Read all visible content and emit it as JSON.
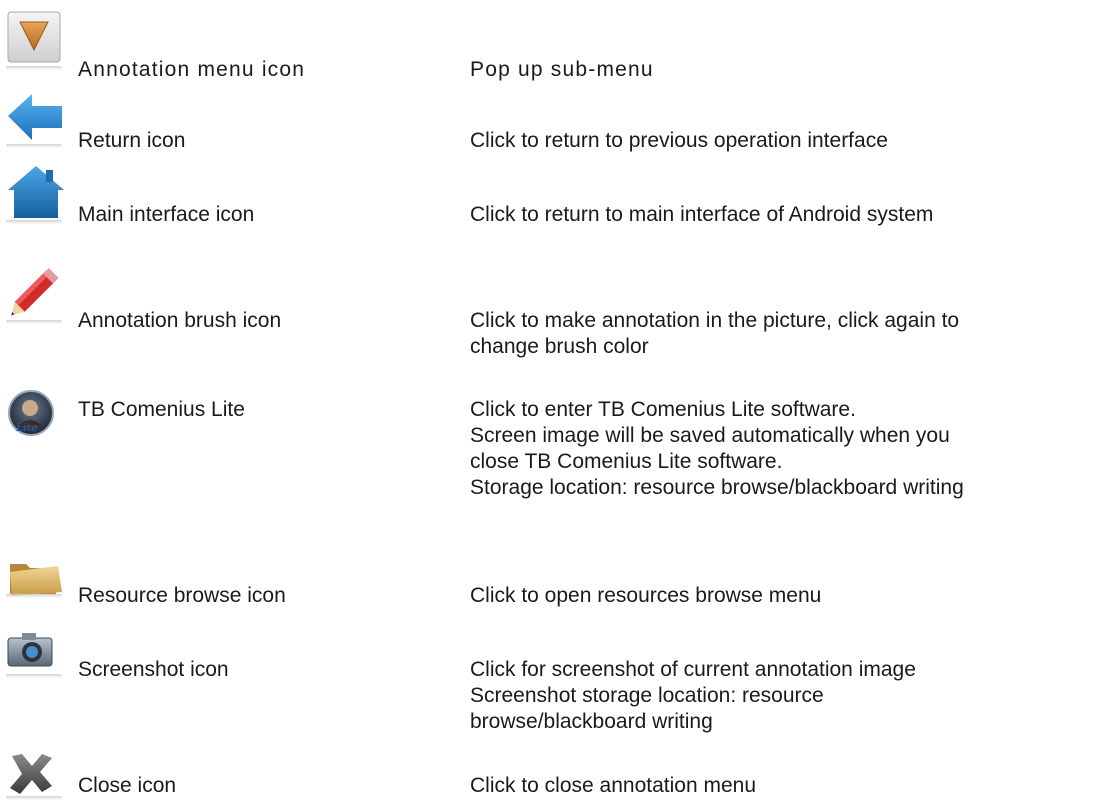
{
  "rows": [
    {
      "name": "Annotation menu icon",
      "desc": [
        "Pop up sub-menu"
      ],
      "icon": "triangle-down-icon"
    },
    {
      "name": "Return icon",
      "desc": [
        "Click to return to previous operation interface"
      ],
      "icon": "arrow-left-icon"
    },
    {
      "name": "Main interface icon",
      "desc": [
        "Click to return to main interface of Android system"
      ],
      "icon": "home-icon"
    },
    {
      "name": "Annotation brush icon",
      "desc": [
        "Click to make annotation in the picture, click again to",
        "change brush color"
      ],
      "icon": "pencil-icon"
    },
    {
      "name": "TB Comenius Lite",
      "desc": [
        "Click to enter TB Comenius Lite software.",
        "Screen image will be saved automatically when you",
        "close TB Comenius Lite software.",
        "Storage location: resource browse/blackboard writing"
      ],
      "icon": "comenius-lite-icon",
      "icon_text": "Lite"
    },
    {
      "name": "Resource browse icon",
      "desc": [
        "Click to open resources browse menu"
      ],
      "icon": "folder-icon"
    },
    {
      "name": "Screenshot icon",
      "desc": [
        "Click for screenshot of current annotation image",
        "Screenshot storage location: resource",
        "browse/blackboard writing"
      ],
      "icon": "camera-icon"
    },
    {
      "name": "Close icon",
      "desc": [
        "Click to close annotation menu"
      ],
      "icon": "close-x-icon"
    }
  ],
  "colors": {
    "accent_blue": "#1f78c8",
    "arrow_orange": "#c8782a",
    "pencil_red": "#d42a2a",
    "folder_tan": "#d8b56a"
  }
}
